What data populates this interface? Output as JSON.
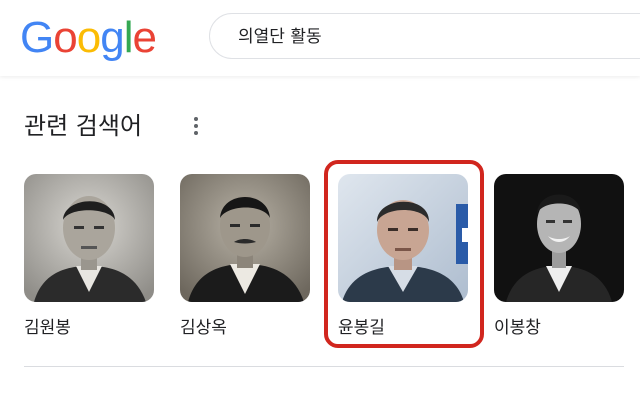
{
  "header": {
    "logo_letters": [
      {
        "char": "G",
        "color": "#4285F4"
      },
      {
        "char": "o",
        "color": "#EA4335"
      },
      {
        "char": "o",
        "color": "#FBBC05"
      },
      {
        "char": "g",
        "color": "#4285F4"
      },
      {
        "char": "l",
        "color": "#34A853"
      },
      {
        "char": "e",
        "color": "#EA4335"
      }
    ],
    "search_query": "의열단 활동"
  },
  "related": {
    "title": "관련 검색어",
    "more_icon": "more-vert-icon",
    "items": [
      {
        "label": "김원봉",
        "photo": "portrait-photo"
      },
      {
        "label": "김상옥",
        "photo": "portrait-photo"
      },
      {
        "label": "윤봉길",
        "photo": "portrait-photo",
        "highlighted": true
      },
      {
        "label": "이봉창",
        "photo": "portrait-photo"
      }
    ]
  },
  "colors": {
    "highlight": "#d1261e",
    "divider": "#dadce0"
  }
}
